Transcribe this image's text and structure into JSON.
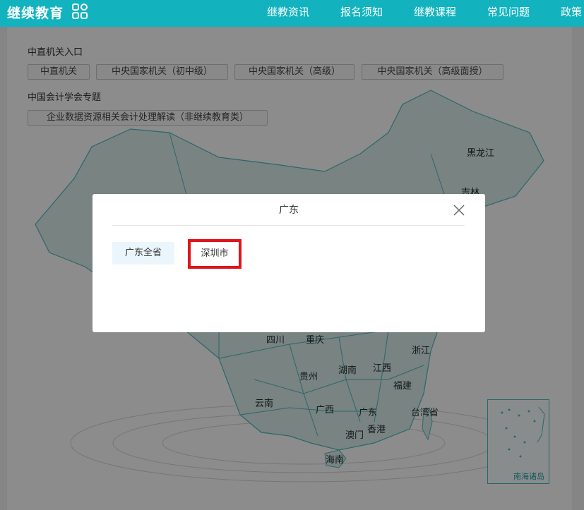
{
  "header": {
    "logo": "继续教育",
    "nav": [
      "继教资讯",
      "报名须知",
      "继教课程",
      "常见问题",
      "政策"
    ]
  },
  "sections": {
    "central_title": "中直机关入口",
    "central_links": [
      "中直机关",
      "中央国家机关（初中级）",
      "中央国家机关（高级）",
      "中央国家机关（高级面授）"
    ],
    "cas_title": "中国会计学会专题",
    "cas_links": [
      "企业数据资源相关会计处理解读（非继续教育类）"
    ]
  },
  "map": {
    "provinces": [
      "黑龙江",
      "吉林",
      "四川",
      "重庆",
      "浙江",
      "贵州",
      "湖南",
      "江西",
      "福建",
      "云南",
      "广西",
      "广东",
      "台湾省",
      "香港",
      "澳门",
      "海南"
    ],
    "inset_label": "南海诸岛"
  },
  "modal": {
    "title": "广东",
    "options": [
      "广东全省",
      "深圳市"
    ]
  },
  "colors": {
    "header_bg": "#12b3bf",
    "map_fill": "#dcefed",
    "highlight_border": "#e0141a"
  }
}
